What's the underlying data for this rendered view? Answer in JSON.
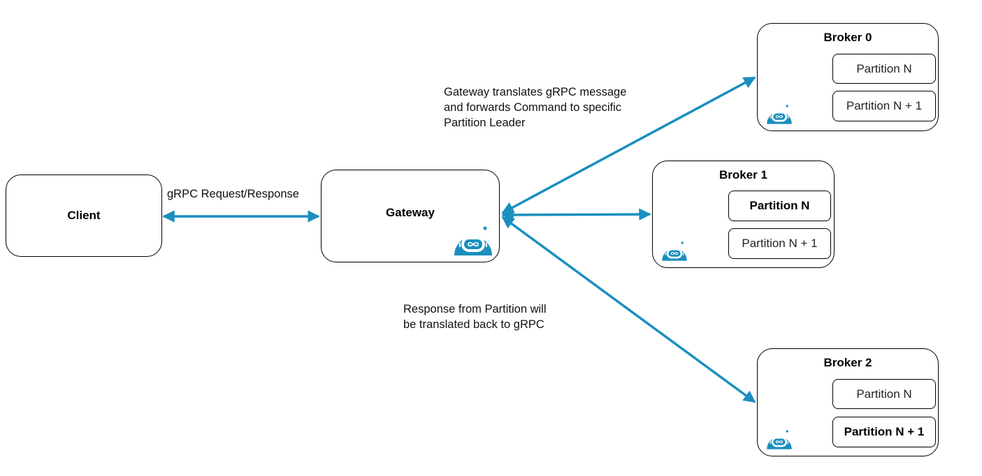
{
  "colors": {
    "accent": "#1a8fbe",
    "border": "#000000"
  },
  "nodes": {
    "client": {
      "label": "Client"
    },
    "gateway": {
      "label": "Gateway",
      "icon": "robot-logo-icon"
    },
    "brokers": [
      {
        "label": "Broker 0",
        "icon": "robot-logo-icon",
        "partitions": [
          {
            "label": "Partition N",
            "leader": false
          },
          {
            "label": "Partition N + 1",
            "leader": false
          }
        ]
      },
      {
        "label": "Broker 1",
        "icon": "robot-logo-icon",
        "partitions": [
          {
            "label": "Partition N",
            "leader": true
          },
          {
            "label": "Partition N + 1",
            "leader": false
          }
        ]
      },
      {
        "label": "Broker 2",
        "icon": "robot-logo-icon",
        "partitions": [
          {
            "label": "Partition N",
            "leader": false
          },
          {
            "label": "Partition N + 1",
            "leader": true
          }
        ]
      }
    ]
  },
  "edges": [
    {
      "from": "client",
      "to": "gateway",
      "label": "gRPC Request/Response",
      "bidirectional": true
    },
    {
      "from": "gateway",
      "to": "broker-0",
      "bidirectional": true
    },
    {
      "from": "gateway",
      "to": "broker-1",
      "bidirectional": true
    },
    {
      "from": "gateway",
      "to": "broker-2",
      "bidirectional": true
    }
  ],
  "annotations": {
    "forward": "Gateway translates gRPC message\nand forwards Command to specific\nPartition Leader",
    "response": "Response from Partition will\nbe translated back to gRPC"
  }
}
